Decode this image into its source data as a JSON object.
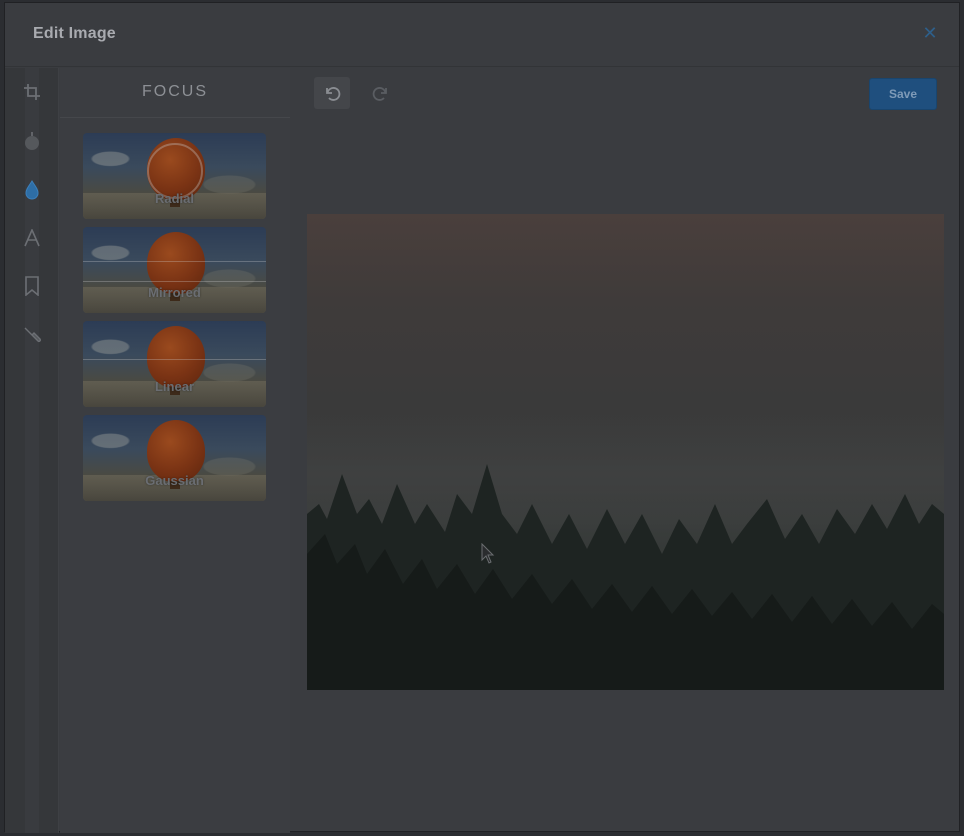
{
  "dialog": {
    "title": "Edit Image",
    "close_icon": "close-icon"
  },
  "tools": [
    {
      "icon": "crop-icon",
      "label": ""
    },
    {
      "icon": "bomb-filter-icon",
      "label": ""
    },
    {
      "icon": "drop-icon",
      "label": ""
    },
    {
      "icon": "text-icon",
      "label": ""
    },
    {
      "icon": "bookmark-icon",
      "label": ""
    },
    {
      "icon": "brush-icon",
      "label": ""
    }
  ],
  "panel": {
    "title": "FOCUS",
    "presets": [
      {
        "label": "Radial"
      },
      {
        "label": "Mirrored"
      },
      {
        "label": "Linear"
      },
      {
        "label": "Gaussian"
      }
    ]
  },
  "toolbar": {
    "undo_icon": "undo-icon",
    "redo_icon": "redo-icon",
    "save_label": "Save"
  },
  "colors": {
    "accent": "#1f4f7e",
    "active_tool": "#2e6ea6",
    "overlay_bg": "#3a3c40"
  }
}
